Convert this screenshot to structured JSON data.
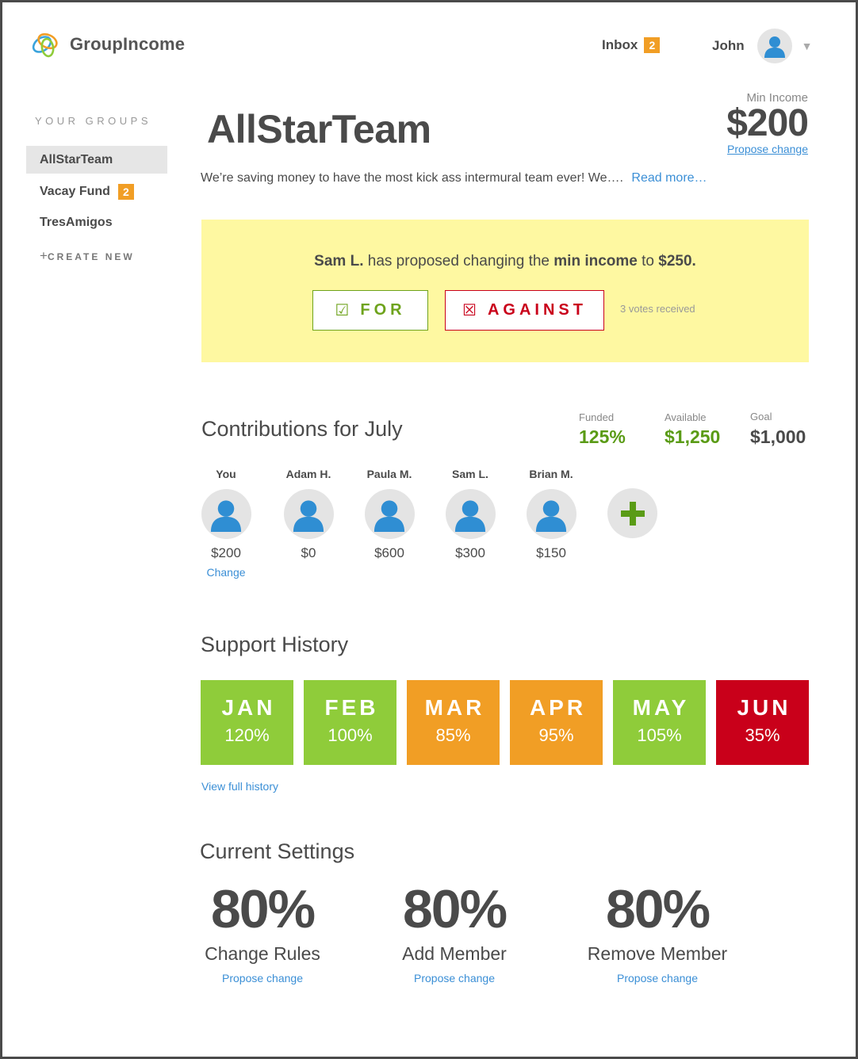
{
  "app": {
    "name": "GroupIncome",
    "logo_icon": "rings-logo-icon"
  },
  "header": {
    "inbox_label": "Inbox",
    "inbox_count": "2",
    "user_name": "John",
    "dropdown_icon": "caret-down-icon"
  },
  "sidebar": {
    "heading": "YOUR GROUPS",
    "groups": [
      {
        "label": "AllStarTeam",
        "active": true
      },
      {
        "label": "Vacay Fund",
        "badge": "2"
      },
      {
        "label": "TresAmigos"
      }
    ],
    "create_new": "CREATE NEW"
  },
  "group": {
    "title": "AllStarTeam",
    "min_income_label": "Min Income",
    "min_income_value": "$200",
    "propose_change": "Propose change",
    "description": "We’re saving money to have the most kick ass intermural team ever! We….",
    "read_more": "Read more…"
  },
  "proposal": {
    "proposer": "Sam L.",
    "text_middle": " has proposed changing the ",
    "field": "min income",
    "text_to": " to ",
    "value": "$250.",
    "for_label": "FOR",
    "for_icon": "☑",
    "against_label": "AGAINST",
    "against_icon": "☒",
    "votes": "3 votes received"
  },
  "contributions": {
    "title": "Contributions for July",
    "stats": [
      {
        "label": "Funded",
        "value": "125%",
        "color": "#5a9b16"
      },
      {
        "label": "Available",
        "value": "$1,250",
        "color": "#5a9b16"
      },
      {
        "label": "Goal",
        "value": "$1,000",
        "color": "#4a4a4a"
      }
    ],
    "members": [
      {
        "name": "You",
        "amount": "$200",
        "action": "Change"
      },
      {
        "name": "Adam H.",
        "amount": "$0"
      },
      {
        "name": "Paula M.",
        "amount": "$600"
      },
      {
        "name": "Sam L.",
        "amount": "$300"
      },
      {
        "name": "Brian M.",
        "amount": "$150"
      }
    ],
    "add_icon": "plus-icon"
  },
  "history": {
    "title": "Support History",
    "months": [
      {
        "month": "JAN",
        "pct": "120%",
        "color": "#8fcc3a"
      },
      {
        "month": "FEB",
        "pct": "100%",
        "color": "#8fcc3a"
      },
      {
        "month": "MAR",
        "pct": "85%",
        "color": "#f19e25"
      },
      {
        "month": "APR",
        "pct": "95%",
        "color": "#f19e25"
      },
      {
        "month": "MAY",
        "pct": "105%",
        "color": "#8fcc3a"
      },
      {
        "month": "JUN",
        "pct": "35%",
        "color": "#c9001a"
      }
    ],
    "view_full": "View full history"
  },
  "settings": {
    "title": "Current Settings",
    "items": [
      {
        "value": "80%",
        "name": "Change Rules",
        "link": "Propose change"
      },
      {
        "value": "80%",
        "name": "Add Member",
        "link": "Propose change"
      },
      {
        "value": "80%",
        "name": "Remove Member",
        "link": "Propose change"
      }
    ]
  },
  "colors": {
    "link": "#3b8fd6",
    "badge": "#f19e25",
    "proposal_bg": "#fef8a1",
    "for": "#6ea31c",
    "against": "#c9001a",
    "avatar_blue": "#2f8ed3"
  }
}
